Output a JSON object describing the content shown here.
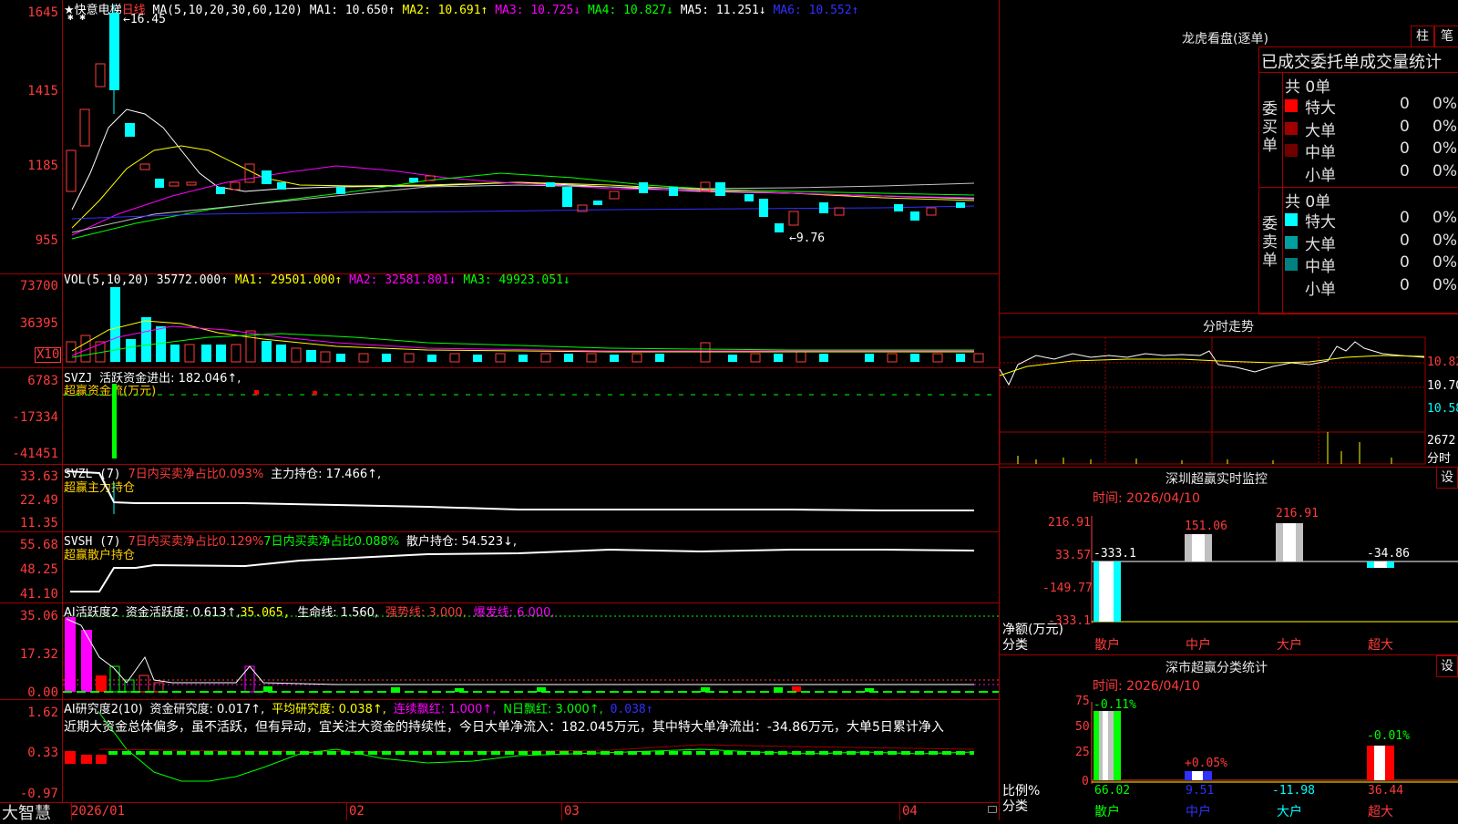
{
  "chart_title": {
    "star": "★",
    "name": "快意电梯",
    "period": "日线"
  },
  "ma_header": {
    "params": "MA(5,10,20,30,60,120)",
    "ma1": "MA1: 10.650↑",
    "ma2": "MA2: 10.691↑",
    "ma3": "MA3: 10.725↓",
    "ma4": "MA4: 10.827↓",
    "ma5": "MA5: 11.251↓",
    "ma6": "MA6: 10.552↑"
  },
  "price_axis": [
    "1645",
    "1415",
    "1185",
    "955"
  ],
  "price_marks": {
    "high": "←16.45",
    "low": "←9.76",
    "stars": "✱ ✱"
  },
  "vol_header": {
    "params": "VOL(5,10,20)",
    "value": "35772.000↑",
    "ma1": "MA1: 29501.000↑",
    "ma2": "MA2: 32581.801↓",
    "ma3": "MA3: 49923.051↓"
  },
  "vol_axis": [
    "73700",
    "36395"
  ],
  "vol_unit": "X10",
  "svzj": {
    "name": "SVZJ",
    "label": "活跃资金进出: 182.046↑,",
    "sub": "超赢资金流(万元)"
  },
  "svzj_axis": [
    "6783",
    "-17334",
    "-41451"
  ],
  "svzl": {
    "name": "SVZL (7)",
    "ratio": "7日内买卖净占比0.093%",
    "hold": "主力持仓: 17.466↑,",
    "sub": "超赢主力持仓"
  },
  "svzl_axis": [
    "33.63",
    "22.49",
    "11.35"
  ],
  "svsh": {
    "name": "SVSH (7)",
    "ratio1": "7日内买卖净占比0.129%",
    "ratio2": "7日内买卖净占比0.088%",
    "hold": "散户持仓: 54.523↓,",
    "sub": "超赢散户持仓"
  },
  "svsh_axis": [
    "55.68",
    "48.25",
    "41.10"
  ],
  "ai1": {
    "name": "AI活跃度2",
    "l1": "资金活跃度: 0.613↑,",
    "l2": "35.065,",
    "l3": "生命线: 1.560,",
    "l4": "强势线: 3.000,",
    "l5": "爆发线: 6.000,"
  },
  "ai1_axis": [
    "35.06",
    "17.32",
    "0.00"
  ],
  "ai2": {
    "name": "AI研究度2(10)",
    "l1": "资金研究度: 0.017↑,",
    "l2": "平均研究度: 0.038↑,",
    "l3": "连续飘红: 1.000↑,",
    "l4": "N日飘红: 3.000↑,",
    "l5": "0.038↑",
    "text": "近期大资金总体偏多，虽不活跃，但有异动，宜关注大资金的持续性，今日大单净流入：182.045万元，其中特大单净流出：-34.86万元，大单5日累计净入"
  },
  "ai2_axis": [
    "1.62",
    "0.33",
    "-0.97"
  ],
  "bottom": {
    "logo": "大智慧",
    "dates": [
      "2026/01",
      "02",
      "03",
      "04"
    ]
  },
  "dragon": {
    "title": "龙虎看盘(逐单)",
    "btn1": "柱",
    "btn2": "笔",
    "header": "已成交委托单成交量统计",
    "buy_label": "委买单",
    "sell_label": "委卖单",
    "buy_total": "共 0单",
    "sell_total": "共 0单",
    "buy_rows": [
      {
        "name": "特大",
        "count": "0",
        "pct": "0%",
        "color": "#ff0000"
      },
      {
        "name": "大单",
        "count": "0",
        "pct": "0%",
        "color": "#a00000"
      },
      {
        "name": "中单",
        "count": "0",
        "pct": "0%",
        "color": "#700000"
      },
      {
        "name": "小单",
        "count": "0",
        "pct": "0%",
        "color": "#000000"
      }
    ],
    "sell_rows": [
      {
        "name": "特大",
        "count": "0",
        "pct": "0%",
        "color": "#00ffff"
      },
      {
        "name": "大单",
        "count": "0",
        "pct": "0%",
        "color": "#00a0a0"
      },
      {
        "name": "中单",
        "count": "0",
        "pct": "0%",
        "color": "#008080"
      },
      {
        "name": "小单",
        "count": "0",
        "pct": "0%",
        "color": "#000000"
      }
    ]
  },
  "intraday": {
    "title": "分时走势",
    "axis": [
      "10.82",
      "10.70",
      "10.58"
    ],
    "vol": "2672",
    "vol_unit": "分时"
  },
  "sz_monitor": {
    "title": "深圳超赢实时监控",
    "btn": "设",
    "time": "时间: 2026/04/10",
    "axis": [
      "216.91",
      "33.57",
      "-149.77",
      "-333.1"
    ],
    "ylabel": "净额(万元)",
    "xlabel": "分类",
    "categories": [
      "散户",
      "中户",
      "大户",
      "超大"
    ],
    "bar_labels": [
      "-333.1",
      "151.06",
      "216.91",
      "-34.86"
    ]
  },
  "sz_class": {
    "title": "深市超赢分类统计",
    "btn": "设",
    "time": "时间: 2026/04/10",
    "axis": [
      "75",
      "50",
      "25",
      "0"
    ],
    "ylabel": "比例%",
    "xlabel": "分类",
    "categories": [
      "散户",
      "中户",
      "大户",
      "超大"
    ],
    "bar_labels": [
      "-0.11%",
      "+0.05%",
      "",
      "-0.01%"
    ],
    "bottom_values": [
      "66.02",
      "9.51",
      "-11.98",
      "36.44"
    ]
  }
}
